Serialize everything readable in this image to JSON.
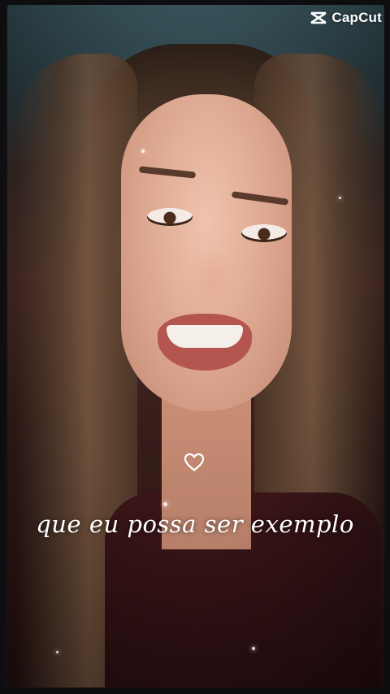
{
  "watermark": {
    "text": "CapCut",
    "icon": "capcut-logo-icon",
    "color": "#ffffff"
  },
  "overlay": {
    "heart_icon": "heart-outline-icon",
    "caption": "que eu possa ser exemplo"
  },
  "colors": {
    "caption_text": "#ffffff",
    "background": "#101012"
  }
}
